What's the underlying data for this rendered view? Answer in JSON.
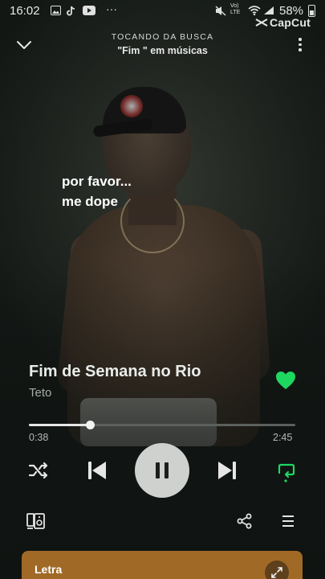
{
  "status_bar": {
    "time": "16:02",
    "battery": "58%",
    "network": "LTE",
    "volte": "Vo)"
  },
  "watermark": {
    "label": "CapCut"
  },
  "header": {
    "context": "TOCANDO DA BUSCA",
    "query": "\"Fim \" em músicas"
  },
  "lyrics_overlay": [
    "por favor...",
    "me dope"
  ],
  "track": {
    "title": "Fim de Semana no Rio",
    "artist": "Teto",
    "liked": true,
    "elapsed": "0:38",
    "duration": "2:45",
    "progress": 0.23
  },
  "controls": {
    "shuffle": "shuffle-icon",
    "previous": "skip-previous-icon",
    "play_state": "paused-icon",
    "next": "skip-next-icon",
    "repeat": "repeat-icon"
  },
  "bottom_row": {
    "devices": "connect-devices-icon",
    "share": "share-icon",
    "queue": "queue-icon"
  },
  "lyrics_card": {
    "label": "Letra"
  },
  "colors": {
    "accent_green": "#1ed760",
    "lyrics_card": "#a06a26"
  }
}
